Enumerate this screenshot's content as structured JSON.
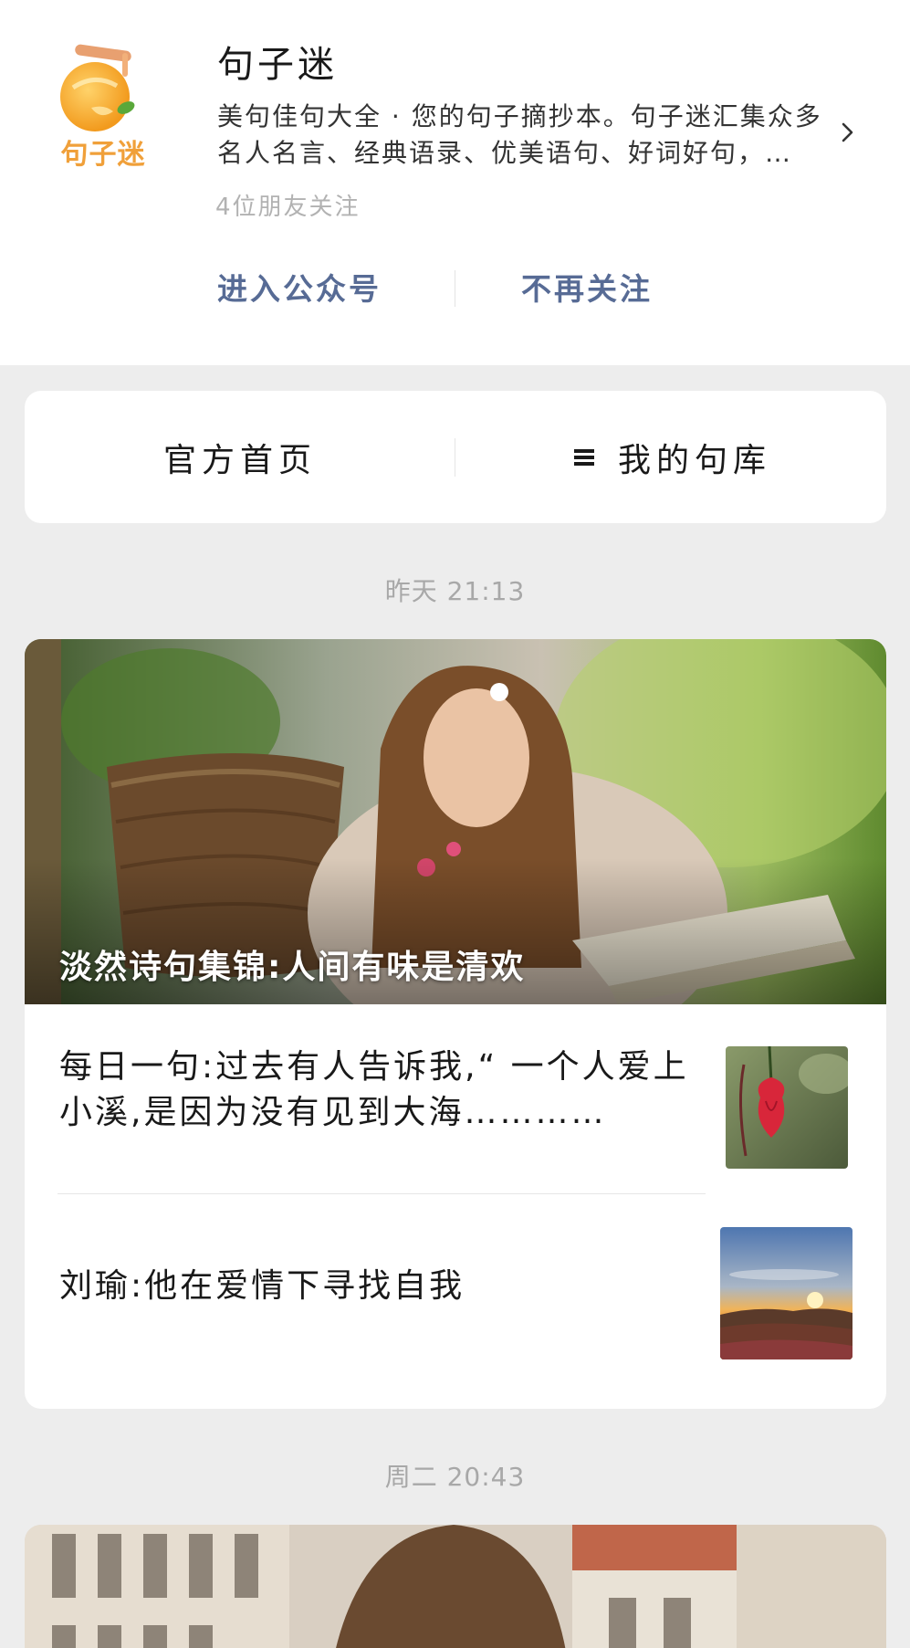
{
  "account": {
    "logo_text": "句子迷",
    "name": "句子迷",
    "description": "美句佳句大全 · 您的句子摘抄本。句子迷汇集众多名人名言、经典语录、优美语句、好词好句，…",
    "followers": "4位朋友关注",
    "enter_label": "进入公众号",
    "unfollow_label": "不再关注"
  },
  "menu": {
    "home_label": "官方首页",
    "library_label": "我的句库"
  },
  "messages": [
    {
      "time": "昨天 21:13",
      "cover_title": "淡然诗句集锦:人间有味是清欢",
      "items": [
        {
          "title": "每日一句:过去有人告诉我,“ 一个人爱上小溪,是因为没有见到大海…………"
        },
        {
          "title": "刘瑜:他在爱情下寻找自我"
        }
      ]
    },
    {
      "time": "周二 20:43"
    }
  ],
  "colors": {
    "link": "#576b95",
    "background": "#ededed",
    "meta_text": "#a8a8a8"
  }
}
